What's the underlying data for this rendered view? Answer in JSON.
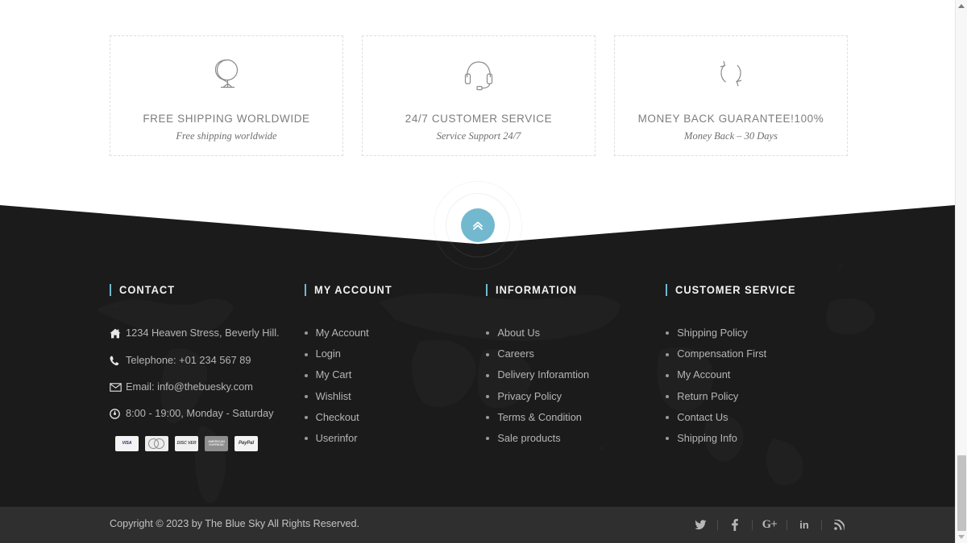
{
  "features": [
    {
      "icon": "globe-icon",
      "title": "FREE SHIPPING WORLDWIDE",
      "subtitle": "Free shipping worldwide"
    },
    {
      "icon": "headset-icon",
      "title": "24/7 CUSTOMER SERVICE",
      "subtitle": "Service Support 24/7"
    },
    {
      "icon": "refresh-arrows-icon",
      "title": "MONEY BACK GUARANTEE!100%",
      "subtitle": "Money Back – 30 Days"
    }
  ],
  "scroll_top": {
    "icon": "double-chevron-up-icon",
    "label": "Scroll to top",
    "color": "#72b9cf"
  },
  "footer": {
    "accent_color": "#72b9cf",
    "background_color": "#1b1b1b",
    "columns": [
      {
        "heading": "CONTACT",
        "contact_items": [
          {
            "icon": "home-icon",
            "text": "1234 Heaven Stress, Beverly Hill."
          },
          {
            "icon": "phone-icon",
            "text": "Telephone: +01 234 567 89"
          },
          {
            "icon": "envelope-icon",
            "text": "Email: info@thebuesky.com"
          },
          {
            "icon": "clock-icon",
            "text": "8:00 - 19:00, Monday - Saturday"
          }
        ],
        "payment_cards": [
          {
            "name": "visa-card-icon",
            "label": "VISA"
          },
          {
            "name": "mastercard-card-icon",
            "label": ""
          },
          {
            "name": "discover-card-icon",
            "label": "DISC VER"
          },
          {
            "name": "american-express-card-icon",
            "label": "AMERICAN EXPRESS"
          },
          {
            "name": "paypal-card-icon",
            "label": "PayPal"
          }
        ]
      },
      {
        "heading": "MY ACCOUNT",
        "links": [
          "My Account",
          "Login",
          "My Cart",
          "Wishlist",
          "Checkout",
          "Userinfor"
        ]
      },
      {
        "heading": "INFORMATION",
        "links": [
          "About Us",
          "Careers",
          "Delivery Inforamtion",
          "Privacy Policy",
          "Terms & Condition",
          "Sale products"
        ]
      },
      {
        "heading": "CUSTOMER SERVICE",
        "links": [
          "Shipping Policy",
          "Compensation First",
          "My Account",
          "Return Policy",
          "Contact Us",
          "Shipping Info"
        ]
      }
    ]
  },
  "bottom_bar": {
    "copyright": "Copyright © 2023 by The Blue Sky All Rights Reserved.",
    "background_color": "#2f2f2f",
    "social": [
      {
        "name": "twitter-icon",
        "label": ""
      },
      {
        "name": "facebook-icon",
        "label": "f"
      },
      {
        "name": "google-plus-icon",
        "label": "G+"
      },
      {
        "name": "linkedin-icon",
        "label": "in"
      },
      {
        "name": "rss-icon",
        "label": ""
      }
    ]
  },
  "scrollbar": {
    "up_arrow": "scrollbar-up-arrow",
    "down_arrow": "scrollbar-down-arrow"
  }
}
